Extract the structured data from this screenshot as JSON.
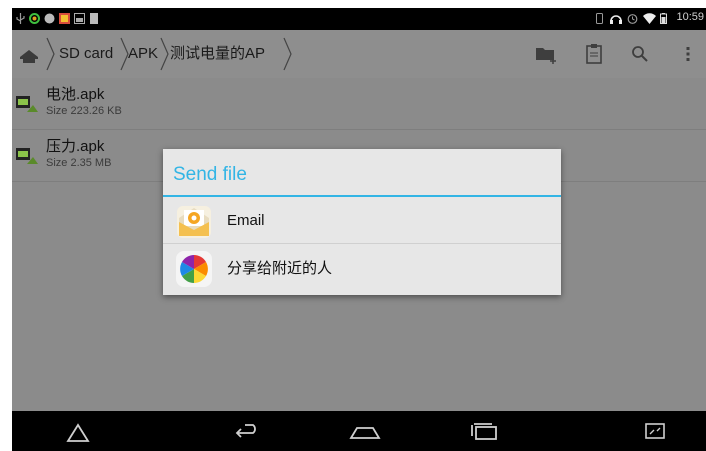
{
  "status_bar": {
    "time": "10:59",
    "left_icons": [
      "usb-icon",
      "app-notification-icon",
      "app-notification-icon",
      "image-notification-icon",
      "image-notification-icon",
      "storage-notification-icon"
    ],
    "right_icons": [
      "vibrate-icon",
      "headset-icon",
      "alarm-icon",
      "wifi-icon",
      "battery-icon"
    ]
  },
  "toolbar": {
    "breadcrumbs": [
      "SD card",
      "APK",
      "测试电量的AP"
    ],
    "actions": [
      "new-folder-icon",
      "clipboard-icon",
      "search-icon",
      "overflow-menu-icon"
    ]
  },
  "files": [
    {
      "name": "电池.apk",
      "size": "Size 223.26 KB"
    },
    {
      "name": "压力.apk",
      "size": "Size 2.35 MB"
    }
  ],
  "dialog": {
    "title": "Send file",
    "options": [
      {
        "label": "Email",
        "icon": "email-icon"
      },
      {
        "label": "分享给附近的人",
        "icon": "share-nearby-icon"
      }
    ]
  },
  "colors": {
    "accent": "#33b5e5",
    "dim_background": "#8b8b8b"
  },
  "nav_bar": [
    "back-icon",
    "home-icon",
    "recent-apps-icon",
    "screenshot-icon"
  ]
}
